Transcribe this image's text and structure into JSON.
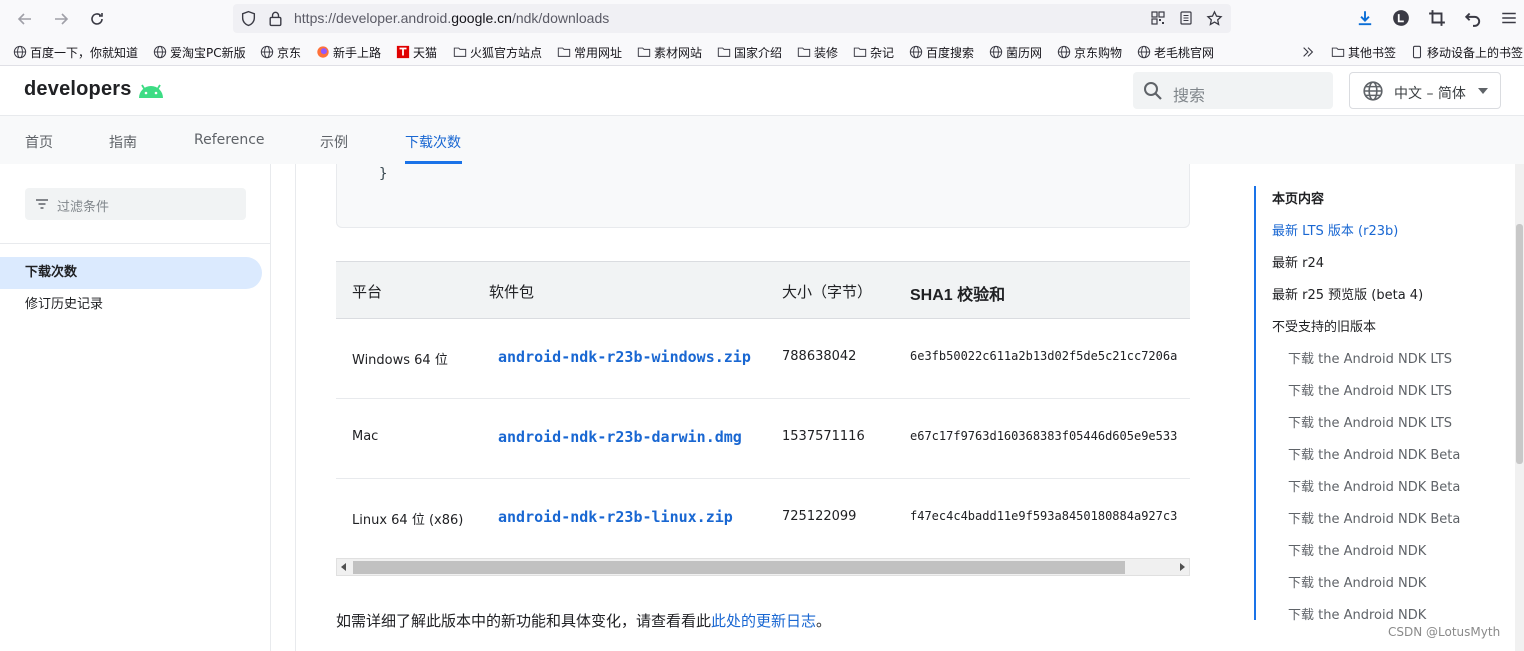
{
  "browser": {
    "url_prefix": "https://developer.android.",
    "url_domain": "google.cn",
    "url_path": "/ndk/downloads"
  },
  "bookmarks": [
    {
      "label": "百度一下，你就知道",
      "icon": "globe-icon"
    },
    {
      "label": "爱淘宝PC新版",
      "icon": "globe-icon"
    },
    {
      "label": "京东",
      "icon": "globe-icon"
    },
    {
      "label": "新手上路",
      "icon": "firefox-icon"
    },
    {
      "label": "天猫",
      "icon": "tmall-icon"
    },
    {
      "label": "火狐官方站点",
      "icon": "folder-icon"
    },
    {
      "label": "常用网址",
      "icon": "folder-icon"
    },
    {
      "label": "素材网站",
      "icon": "folder-icon"
    },
    {
      "label": "国家介绍",
      "icon": "folder-icon"
    },
    {
      "label": "装修",
      "icon": "folder-icon"
    },
    {
      "label": "杂记",
      "icon": "folder-icon"
    },
    {
      "label": "百度搜索",
      "icon": "globe-icon"
    },
    {
      "label": "菌历网",
      "icon": "globe-icon"
    },
    {
      "label": "京东购物",
      "icon": "globe-icon"
    },
    {
      "label": "老毛桃官网",
      "icon": "globe-icon"
    }
  ],
  "bookmarks_right": {
    "other": "其他书签",
    "mobile": "移动设备上的书签"
  },
  "header": {
    "logo_text": "developers",
    "search_placeholder": "搜索",
    "language": "中文 – 简体"
  },
  "tabs": [
    {
      "label": "首页"
    },
    {
      "label": "指南"
    },
    {
      "label": "Reference"
    },
    {
      "label": "示例"
    },
    {
      "label": "下载次数"
    }
  ],
  "leftnav": {
    "filter_placeholder": "过滤条件",
    "items": [
      {
        "label": "下载次数"
      },
      {
        "label": "修订历史记录"
      }
    ]
  },
  "code": {
    "brace": "}"
  },
  "table": {
    "headers": [
      "平台",
      "软件包",
      "大小（字节）",
      "SHA1 校验和"
    ],
    "rows": [
      {
        "platform": "Windows 64 位",
        "package": "android-ndk-r23b-windows.zip",
        "size": "788638042",
        "sha1": "6e3fb50022c611a2b13d02f5de5c21cc7206a"
      },
      {
        "platform": "Mac",
        "package": "android-ndk-r23b-darwin.dmg",
        "size": "1537571116",
        "sha1": "e67c17f9763d160368383f05446d605e9e533"
      },
      {
        "platform": "Linux 64 位 (x86)",
        "package": "android-ndk-r23b-linux.zip",
        "size": "725122099",
        "sha1": "f47ec4c4badd11e9f593a8450180884a927c3"
      }
    ]
  },
  "note": {
    "text": "如需详细了解此版本中的新功能和具体变化，请查看看此",
    "link": "此处的更新日志",
    "end": "。"
  },
  "toc": {
    "title": "本页内容",
    "items": [
      {
        "label": "最新 LTS 版本 (r23b)",
        "level": 1
      },
      {
        "label": "最新 r24",
        "level": 1
      },
      {
        "label": "最新 r25 预览版 (beta 4)",
        "level": 1
      },
      {
        "label": "不受支持的旧版本",
        "level": 1
      },
      {
        "label": "下载 the Android NDK LTS",
        "level": 2
      },
      {
        "label": "下载 the Android NDK LTS",
        "level": 2
      },
      {
        "label": "下载 the Android NDK LTS",
        "level": 2
      },
      {
        "label": "下载 the Android NDK Beta",
        "level": 2
      },
      {
        "label": "下载 the Android NDK Beta",
        "level": 2
      },
      {
        "label": "下载 the Android NDK Beta",
        "level": 2
      },
      {
        "label": "下载 the Android NDK",
        "level": 2
      },
      {
        "label": "下载 the Android NDK",
        "level": 2
      },
      {
        "label": "下载 the Android NDK",
        "level": 2
      }
    ]
  },
  "watermark": "CSDN @LotusMyth",
  "colors": {
    "accent": "#1a73e8",
    "link": "#1967d2",
    "android_green": "#3ddc84"
  }
}
